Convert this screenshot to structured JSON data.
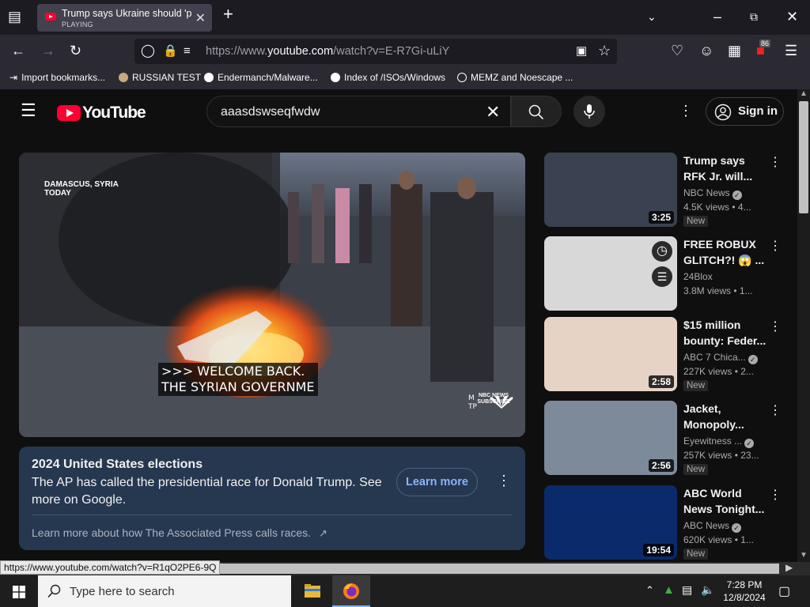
{
  "browser": {
    "tab_title": "Trump says Ukraine should 'pro",
    "tab_status": "PLAYING",
    "url_prefix": "https://www.",
    "url_domain": "youtube.com",
    "url_path": "/watch?v=E-R7Gi-uLiY",
    "extensions_badge": "86",
    "bookmarks": [
      "Import bookmarks...",
      "RUSSIAN TEST",
      "Endermanch/Malware...",
      "Index of /ISOs/Windows",
      "MEMZ and Noescape ..."
    ],
    "status_link": "https://www.youtube.com/watch?v=R1qO2PE6-9Q"
  },
  "youtube": {
    "logo_text": "YouTube",
    "search_value": "aaasdswseqfwdw",
    "sign_in": "Sign in"
  },
  "player": {
    "location": "DAMASCUS, SYRIA\nTODAY",
    "caption": ">>> WELCOME BACK.\nTHE SYRIAN GOVERNME",
    "logo_text": "NBC NEWS\nSUBSCRIBE"
  },
  "election_card": {
    "title": "2024 United States elections",
    "description": "The AP has called the presidential race for Donald Trump. See more on Google.",
    "button": "Learn more",
    "footer": "Learn more about how The Associated Press calls races."
  },
  "recommendations": [
    {
      "title": "Trump says RFK Jr. will...",
      "channel": "NBC News",
      "verified": true,
      "views": "4.5K views",
      "age": "4...",
      "duration": "3:25",
      "badge": "New",
      "thumb_color": "#3a4150"
    },
    {
      "title": "FREE ROBUX GLITCH?! 😱 ...",
      "channel": "24Blox",
      "verified": false,
      "views": "3.8M views",
      "age": "1...",
      "duration": "",
      "badge": "",
      "thumb_color": "#d8d8d8"
    },
    {
      "title": "$15 million bounty: Feder...",
      "channel": "ABC 7 Chica...",
      "verified": true,
      "views": "227K views",
      "age": "2...",
      "duration": "2:58",
      "badge": "New",
      "thumb_color": "#e6d3c6"
    },
    {
      "title": "Jacket, Monopoly...",
      "channel": "Eyewitness ...",
      "verified": true,
      "views": "257K views",
      "age": "23...",
      "duration": "2:56",
      "badge": "New",
      "thumb_color": "#7d8a99"
    },
    {
      "title": "ABC World News Tonight...",
      "channel": "ABC News",
      "verified": true,
      "views": "620K views",
      "age": "1...",
      "duration": "19:54",
      "badge": "New",
      "thumb_color": "#0b2a6b"
    }
  ],
  "taskbar": {
    "search_placeholder": "Type here to search",
    "time": "7:28 PM",
    "date": "12/8/2024"
  }
}
